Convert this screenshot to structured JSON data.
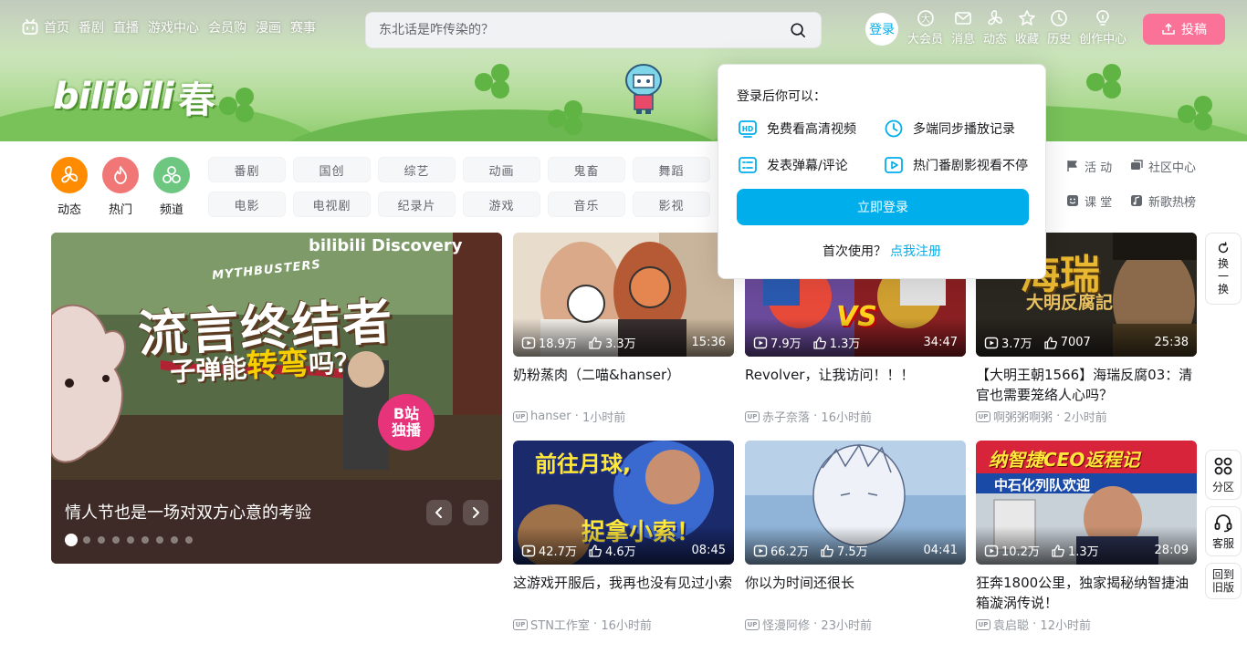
{
  "colors": {
    "brand_blue": "#00aeec",
    "brand_pink": "#fb7299",
    "text_secondary": "#61666d",
    "text_tertiary": "#9499a0"
  },
  "nav": {
    "left_items": [
      "首页",
      "番剧",
      "直播",
      "游戏中心",
      "会员购",
      "漫画",
      "赛事"
    ],
    "search_placeholder": "东北话是咋传染的？",
    "login_avatar": "登录",
    "right_items": [
      {
        "label": "大会员",
        "icon": "vip-icon"
      },
      {
        "label": "消息",
        "icon": "mail-icon"
      },
      {
        "label": "动态",
        "icon": "fan-icon"
      },
      {
        "label": "收藏",
        "icon": "star-icon"
      },
      {
        "label": "历史",
        "icon": "clock-icon"
      },
      {
        "label": "创作中心",
        "icon": "bulb-icon"
      }
    ],
    "upload_label": "投稿"
  },
  "banner": {
    "logo_text": "bilibili",
    "season_text": "春"
  },
  "channels": {
    "big": [
      {
        "label": "动态",
        "color": "#ff8c00"
      },
      {
        "label": "热门",
        "color": "#f07775"
      },
      {
        "label": "频道",
        "color": "#6dc781"
      }
    ],
    "tags": [
      "番剧",
      "国创",
      "综艺",
      "动画",
      "鬼畜",
      "舞蹈",
      "电影",
      "电视剧",
      "纪录片",
      "游戏",
      "音乐",
      "影视"
    ],
    "links": [
      "活 动",
      "社区中心",
      "课 堂",
      "新歌热榜"
    ]
  },
  "carousel": {
    "title": "情人节也是一场对双方心意的考验",
    "dot_count": 9,
    "art": {
      "brand": "bilibili  Discovery",
      "series": "MYTHBUSTERS",
      "headline": "流言终结者",
      "sub_a": "子弹能",
      "sub_b": "转弯",
      "sub_c": "吗？",
      "stamp_a": "B站",
      "stamp_b": "独播"
    }
  },
  "videos": [
    {
      "views": "18.9万",
      "likes": "3.3万",
      "duration": "15:36",
      "title": "奶粉蒸肉（二喵&hanser）",
      "author": "hanser",
      "time": "1小时前"
    },
    {
      "views": "7.9万",
      "likes": "1.3万",
      "duration": "34:47",
      "title": "Revolver，让我访问！！！",
      "author": "赤子奈落",
      "time": "16小时前",
      "art_word": "VS"
    },
    {
      "views": "3.7万",
      "likes": "7007",
      "duration": "25:38",
      "title": "【大明王朝1566】海瑞反腐03：清官也需要笼络人心吗？",
      "author": "啊粥粥啊粥",
      "time": "2小时前",
      "art_word": "海瑞",
      "art_sub": "大明反腐記"
    },
    {
      "views": "42.7万",
      "likes": "4.6万",
      "duration": "08:45",
      "title": "这游戏开服后，我再也没有见过小索",
      "author": "STN工作室",
      "time": "16小时前",
      "art_word": "前往月球,",
      "art_sub": "捉拿小索！"
    },
    {
      "views": "66.2万",
      "likes": "7.5万",
      "duration": "04:41",
      "title": "你以为时间还很长",
      "author": "怪漫阿修",
      "time": "23小时前"
    },
    {
      "views": "10.2万",
      "likes": "1.3万",
      "duration": "28:09",
      "title": "狂奔1800公里，独家揭秘纳智捷油箱漩涡传说！",
      "author": "袁启聪",
      "time": "12小时前",
      "art_word": "纳智捷CEO返程记",
      "art_sub": "中石化列队欢迎"
    }
  ],
  "login_popup": {
    "title": "登录后你可以：",
    "features": [
      {
        "label": "免费看高清视频",
        "icon": "hd-icon"
      },
      {
        "label": "多端同步播放记录",
        "icon": "history-sync-icon"
      },
      {
        "label": "发表弹幕/评论",
        "icon": "danmaku-icon"
      },
      {
        "label": "热门番剧影视看不停",
        "icon": "play-tv-icon"
      }
    ],
    "button": "立即登录",
    "footer_text": "首次使用？",
    "footer_link": "点我注册"
  },
  "tools": {
    "refresh": [
      "换",
      "一",
      "换"
    ],
    "category": "分区",
    "service": "客服",
    "old_version": [
      "回到",
      "旧版"
    ]
  }
}
